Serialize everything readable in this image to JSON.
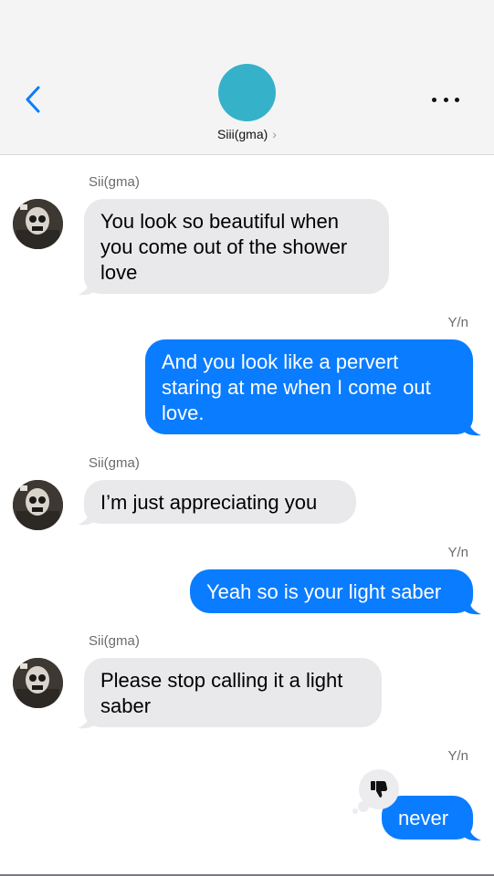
{
  "header": {
    "contact_name": "Siii(gma)",
    "chevron": "›",
    "back_icon": "chevron-left-icon",
    "more_icon": "ellipsis-icon",
    "avatar_color": "#35b2c9"
  },
  "messages": [
    {
      "from": "them",
      "sender": "Sii(gma)",
      "text": "You look so beautiful when you come out of the shower love"
    },
    {
      "from": "me",
      "sender": "Y/n",
      "text": "And you look like a pervert staring at me when I come out love."
    },
    {
      "from": "them",
      "sender": "Sii(gma)",
      "text": "I’m just appreciating you"
    },
    {
      "from": "me",
      "sender": "Y/n",
      "text": "Yeah so is your light saber"
    },
    {
      "from": "them",
      "sender": "Sii(gma)",
      "text": "Please stop calling it a light saber"
    },
    {
      "from": "me",
      "sender": "Y/n",
      "text": "never",
      "reaction": "thumbs-down-icon"
    }
  ],
  "colors": {
    "outgoing_bubble": "#0a7cff",
    "incoming_bubble": "#e9e9eb",
    "accent": "#0a7cff"
  }
}
